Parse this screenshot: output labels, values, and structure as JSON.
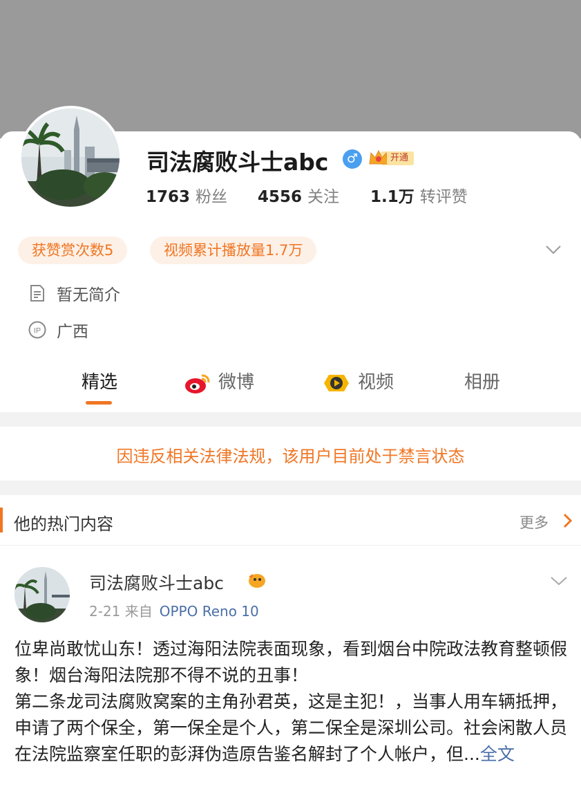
{
  "profile": {
    "name": "司法腐败斗士abc",
    "gender_icon": "male-icon",
    "vip_label": "开通",
    "stats": [
      {
        "value": "1763",
        "label": "粉丝"
      },
      {
        "value": "4556",
        "label": "关注"
      },
      {
        "value": "1.1万",
        "label": "转评赞"
      }
    ],
    "pills": [
      "获赞赏次数5",
      "视频累计播放量1.7万"
    ],
    "bio": "暂无简介",
    "ip_icon_label": "IP",
    "location": "广西"
  },
  "tabs": [
    {
      "label": "精选",
      "active": true
    },
    {
      "label": "微博",
      "icon": "weibo-icon"
    },
    {
      "label": "视频",
      "icon": "video-icon"
    },
    {
      "label": "相册"
    }
  ],
  "banner": "因违反相关法律法规，该用户目前处于禁言状态",
  "hot_section": {
    "title": "他的热门内容",
    "more": "更多"
  },
  "post": {
    "author": "司法腐败斗士abc",
    "date": "2-21",
    "source_prefix": "来自",
    "source": "OPPO Reno 10",
    "text_1": "位卑尚敢忧山东！透过海阳法院表面现象，看到烟台中院政法教育整顿假象！烟台海阳法院那不得不说的丑事！",
    "text_2": "第二条龙司法腐败窝案的主角孙君英，这是主犯！，当事人用车辆抵押，申请了两个保全，第一保全是个人，第二保全是深圳公司。社会闲散人员在法院监察室任职的彭湃伪造原告鉴名解封了个人帐户，但",
    "ellipsis": "...",
    "full_text": "全文"
  },
  "colors": {
    "accent": "#f07624",
    "link": "#4b6fa8",
    "cover": "#9a9a9a"
  }
}
